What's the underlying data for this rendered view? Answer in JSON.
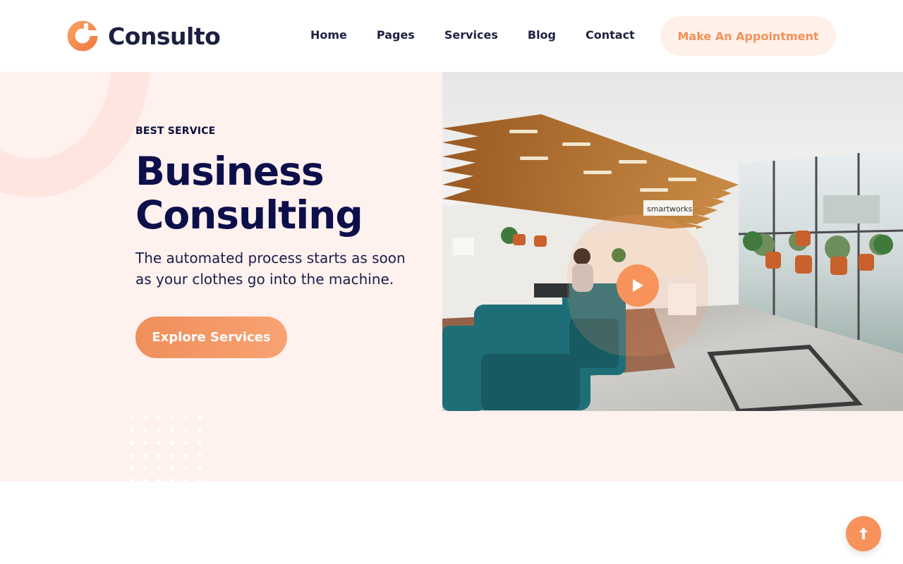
{
  "brand": {
    "name": "Consulto",
    "accent": "#f39059",
    "navy": "#0c0f4a"
  },
  "nav": {
    "items": [
      {
        "label": "Home"
      },
      {
        "label": "Pages"
      },
      {
        "label": "Services"
      },
      {
        "label": "Blog"
      },
      {
        "label": "Contact"
      }
    ],
    "cta_label": "Make An Appointment"
  },
  "hero": {
    "eyebrow": "BEST SERVICE",
    "title_line1": "Business",
    "title_line2": "Consulting",
    "subtitle": "The automated process starts as soon as your clothes go into the machine.",
    "button_label": "Explore Services",
    "image": {
      "sign_text": "smartworks",
      "play_icon": "play-icon"
    }
  },
  "scroll_top_icon": "arrow-up-icon"
}
